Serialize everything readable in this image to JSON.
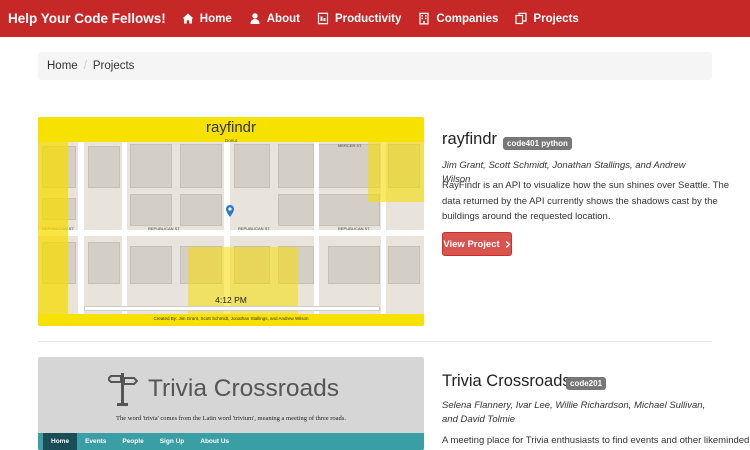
{
  "navbar": {
    "brand": "Help Your Code Fellows!",
    "items": [
      {
        "label": "Home",
        "icon": "home-icon"
      },
      {
        "label": "About",
        "icon": "user-icon"
      },
      {
        "label": "Productivity",
        "icon": "document-icon"
      },
      {
        "label": "Companies",
        "icon": "building-icon"
      },
      {
        "label": "Projects",
        "icon": "files-icon"
      }
    ],
    "color": "#c62828"
  },
  "breadcrumb": {
    "home": "Home",
    "separator": "/",
    "current": "Projects"
  },
  "projects": [
    {
      "title": "rayfindr",
      "tag": "code401 python",
      "authors": "Jim Grant, Scott Schmidt, Jonathan Stallings, and Andrew Wilson",
      "description": "RayFindr is an API to visualize how the sun shines over Seattle. The data returned by the API currently shows the shadows cast by the buildings around the requested location.",
      "button": "View Project",
      "button_icon": "chevron-right-icon",
      "screenshot": {
        "title": "rayfindr",
        "subtitle": "Donut",
        "time": "4:12 PM",
        "credit": "Created By: Jim Grant, Scott Schmidt, Jonathan Stallings, and Andrew Wilson",
        "streets": [
          "REPUBLICAN ST",
          "REPUBLICAN ST",
          "REPUBLICAN ST",
          "REPUBLICAN ST",
          "MERCER ST"
        ]
      }
    },
    {
      "title": "Trivia Crossroads",
      "tag": "code201",
      "authors": "Selena Flannery, Ivar Lee, Willie Richardson, Michael Sullivan, and David Tolmie",
      "description": "A meeting place for Trivia enthusiasts to find events and other likeminded",
      "screenshot": {
        "title": "Trivia Crossroads",
        "tagline": "The word 'trivia' comes from the Latin word 'trivium', meaning a meeting of three roads.",
        "nav": [
          "Home",
          "Events",
          "People",
          "Sign Up",
          "About Us"
        ]
      }
    }
  ],
  "colors": {
    "danger": "#d9534f",
    "tag": "#777777",
    "trivia_nav": "#3a9ea5"
  }
}
